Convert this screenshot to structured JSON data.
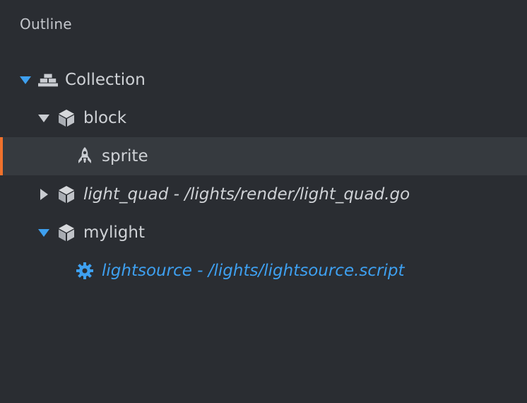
{
  "panel": {
    "title": "Outline"
  },
  "tree": [
    {
      "label": "Collection",
      "icon": "collection-icon",
      "expanded": true,
      "arrow_color": "#3ea0f0"
    },
    {
      "label": "block",
      "icon": "game-object-icon",
      "expanded": true,
      "arrow_color": "#c9ccd1"
    },
    {
      "label": "sprite",
      "icon": "sprite-icon",
      "selected": true
    },
    {
      "label": "light_quad - /lights/render/light_quad.go",
      "icon": "game-object-icon",
      "expanded": false,
      "italic": true
    },
    {
      "label": "mylight",
      "icon": "game-object-icon",
      "expanded": true,
      "arrow_color": "#3ea0f0"
    },
    {
      "label": "lightsource - /lights/lightsource.script",
      "icon": "script-gear-icon",
      "italic": true,
      "link": true
    }
  ],
  "colors": {
    "background": "#2a2d32",
    "selected_row": "#363a3f",
    "selection_accent": "#f0712c",
    "link": "#3ea0f0",
    "text": "#cfd2d6"
  }
}
